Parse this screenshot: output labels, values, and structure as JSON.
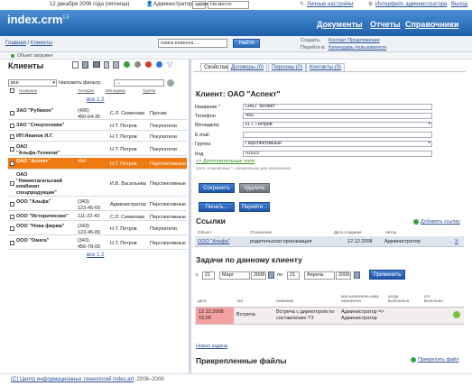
{
  "topbar": {
    "date": "12 декабря 2008 года (пятница)",
    "user": "Администратор",
    "role_value": "администратор",
    "status_value": "На месте",
    "settings_link": "Личные настройки",
    "admin_link": "Интерфейс администратора",
    "logout_link": "Выход"
  },
  "brand": {
    "name": "index.crm",
    "version": "1.5"
  },
  "nav": {
    "documents": "Документы",
    "reports": "Отчеты",
    "directories": "Справочники"
  },
  "breadcrumb": {
    "home": "Главная",
    "sep": " / ",
    "current": "Клиенты"
  },
  "search": {
    "value": "поиск клиента ...",
    "button": "Найти"
  },
  "create": {
    "label": "Создать:",
    "link": "Контакт Предложение",
    "goto_label": "Перейти в:",
    "goto_link": "Календарь пользователя"
  },
  "loading": "Объект загружен",
  "clients": {
    "title": "Клиенты",
    "filter_select": "все",
    "filter_label": "Наложить фильтр:",
    "filter_value": "...",
    "columns": {
      "name": "Название",
      "phone": "Телефон",
      "manager": "Менеджер",
      "group": "Группа"
    },
    "pager_top": "все 1 2",
    "pager_bottom": "все 1 2",
    "rows": [
      {
        "name": "ЗАО \"Рубикон\"",
        "phone": "(495)\n450-64-35",
        "manager": "С.Л. Семенова",
        "group": "Прочие"
      },
      {
        "name": "ЗАО \"Спецтехника\"",
        "phone": "",
        "manager": "Н.Т. Петров",
        "group": "Покупатели"
      },
      {
        "name": "ИП Иванов И.Г.",
        "phone": "",
        "manager": "Н.Т. Петров",
        "group": "Покупатели"
      },
      {
        "name": "ОАО\n\"Альфа-Телеком\"",
        "phone": "",
        "manager": "Н.Т. Петров",
        "group": "Покупатели"
      },
      {
        "name": "ОАО \"Аспект\"",
        "phone": "456",
        "manager": "Н.Т. Петров",
        "group": "Перспективные"
      },
      {
        "name": "ОАО\n\"Нижнетагильский\nкомбинат\nспецпродукции\"",
        "phone": "",
        "manager": "И.В. Васильева",
        "group": "Перспективные"
      },
      {
        "name": "ООО \"Альфа\"",
        "phone": "(343)\n123-45-69",
        "manager": "Администратор",
        "group": "Перспективные"
      },
      {
        "name": "ООО \"Исторические\"",
        "phone": "111-22-43",
        "manager": "С.Л. Семенова",
        "group": "Перспективные"
      },
      {
        "name": "ООО \"Нова фирма\"",
        "phone": "(343)\n123-45-89",
        "manager": "Н.Т. Петров",
        "group": "Покупатели"
      },
      {
        "name": "ООО \"Омега\"",
        "phone": "(343)\n456-78-09",
        "manager": "Н.Т. Петров",
        "group": "Перспективные"
      }
    ]
  },
  "tabs": {
    "properties": "Свойства",
    "contracts": "Договоры (0)",
    "persons": "Персоны (0)",
    "contacts": "Контакты (0)"
  },
  "client_card": {
    "title": "Клиент: ОАО \"Аспект\"",
    "fields": {
      "name_label": "Название",
      "required_mark": "*",
      "name_value": "ОАО \"Аспект\"",
      "phone_label": "Телефон",
      "phone_value": "456",
      "manager_label": "Менеджер",
      "manager_value": "Н.Т. Петров",
      "email_label": "E-mail",
      "email_value": "",
      "group_label": "Группа",
      "group_value": "Перспективные",
      "code_label": "Код",
      "code_value": "01615"
    },
    "extra_link": ">> Дополнительные поля",
    "required_note": "поля, отмеченные *, обязательны для заполнения",
    "save_button": "Сохранить",
    "delete_button": "Удалить",
    "print_button": "Печать...",
    "goto_button": "Перейти..."
  },
  "links_section": {
    "title": "Ссылки",
    "add_link": "Добавить ссылку",
    "columns": {
      "object": "Объект",
      "relation": "Отношение",
      "date": "Дата создания",
      "author": "Автор"
    },
    "row": {
      "object": "ООО \"Альфа\"",
      "relation": "родительская организация",
      "date": "12.12.2008",
      "author": "Администратор",
      "remove": "X"
    }
  },
  "tasks_section": {
    "title": "Задачи по данному клиенту",
    "from_label": "с",
    "from_day": "21",
    "from_month": "Март",
    "from_year": "2008",
    "to_label": "по",
    "to_day": "21",
    "to_month": "Апрель",
    "to_year": "2009",
    "apply_button": "Применить",
    "columns": {
      "date": "дата",
      "type": "тип",
      "name": "название",
      "who": "кем назначена кому назначена",
      "when": "когда выполнена",
      "who_done": "кто выполнил"
    },
    "row": {
      "date": "12.12.2008 15:00",
      "type": "Встреча",
      "name": "Встреча с директором по составлению ТЗ",
      "who": "Администратор => Администратор"
    },
    "new_task": "Новая задача"
  },
  "files_section": {
    "title": "Прикрепленные файлы",
    "attach_link": "Прикрепить файл"
  },
  "footer": {
    "copyright_link": "(С) Центр информационных технологий index.art",
    "years": ", 2006–2008"
  },
  "colors": {
    "header": "#2a66b8",
    "selected_row": "#f07a12",
    "task_row": "#f4a0a0",
    "accent_blue": "#2a4f9a"
  }
}
